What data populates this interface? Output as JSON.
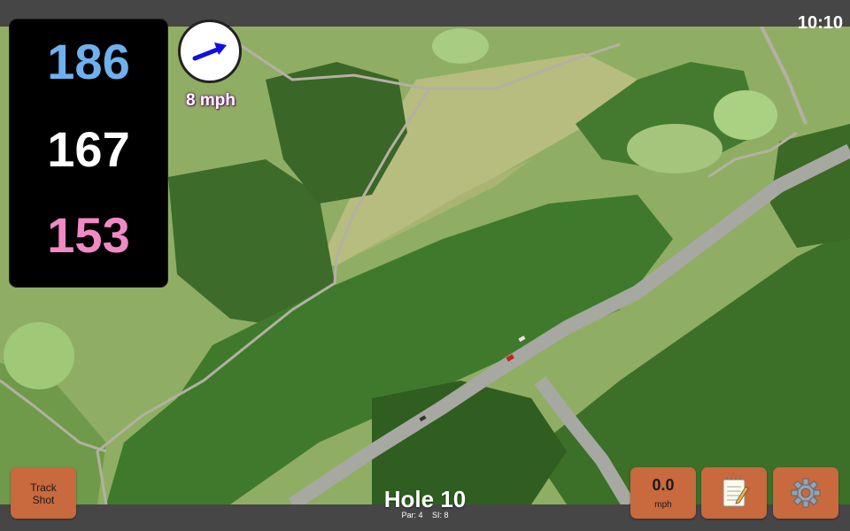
{
  "status_bar": {
    "time": "10:10"
  },
  "distances": {
    "back": "186",
    "middle": "167",
    "front": "153"
  },
  "wind": {
    "speed_text": "8 mph",
    "arrow_icon": "wind-arrow-icon"
  },
  "hole": {
    "title": "Hole 10",
    "par": "Par: 4",
    "stroke_index": "SI: 8"
  },
  "buttons": {
    "track_shot": {
      "line1": "Track",
      "line2": "Shot"
    },
    "speed": {
      "value": "0.0",
      "unit": "mph"
    },
    "notes_icon": "notepad-icon",
    "settings_icon": "gear-icon"
  },
  "colors": {
    "back_distance": "#6fb1ef",
    "middle_distance": "#ffffff",
    "front_distance": "#f08ac5",
    "button": "#c8693e",
    "wind_arrow": "#1010e0"
  }
}
